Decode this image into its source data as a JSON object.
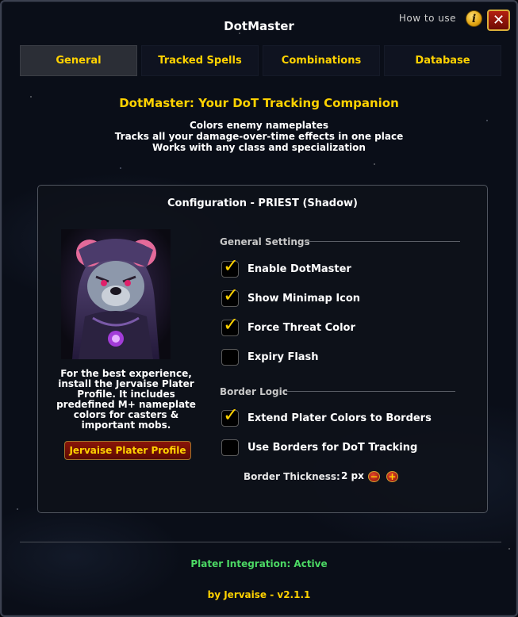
{
  "window": {
    "title": "DotMaster"
  },
  "header": {
    "how_to_use": "How to use",
    "info_icon": "i",
    "close_icon": "✕"
  },
  "tabs": [
    {
      "label": "General",
      "active": true
    },
    {
      "label": "Tracked Spells",
      "active": false
    },
    {
      "label": "Combinations",
      "active": false
    },
    {
      "label": "Database",
      "active": false
    }
  ],
  "intro": {
    "headline": "DotMaster: Your DoT Tracking Companion",
    "lines": [
      "Colors enemy nameplates",
      "Tracks all your damage-over-time effects in one place",
      "Works with any class and specialization"
    ]
  },
  "config": {
    "title": "Configuration - PRIEST (Shadow)",
    "profile_text": [
      "For the best experience,",
      "install the Jervaise Plater",
      "Profile. It includes",
      "predefined M+ nameplate",
      "colors for casters &",
      "important mobs."
    ],
    "profile_button": "Jervaise Plater Profile",
    "general_settings": {
      "heading": "General Settings",
      "options": [
        {
          "label": "Enable DotMaster",
          "checked": true
        },
        {
          "label": "Show Minimap Icon",
          "checked": true
        },
        {
          "label": "Force Threat Color",
          "checked": true
        },
        {
          "label": "Expiry Flash",
          "checked": false
        }
      ]
    },
    "border_logic": {
      "heading": "Border Logic",
      "options": [
        {
          "label": "Extend Plater Colors to Borders",
          "checked": true
        },
        {
          "label": "Use Borders for DoT Tracking",
          "checked": false
        }
      ],
      "thickness_label": "Border Thickness:",
      "thickness_value": "2 px",
      "minus": "−",
      "plus": "+"
    }
  },
  "footer": {
    "status": "Plater Integration: Active",
    "credits": "by Jervaise - v2.1.1"
  },
  "colors": {
    "accent_gold": "#ffd200",
    "status_green": "#4cd964",
    "button_red": "#8a1508"
  }
}
